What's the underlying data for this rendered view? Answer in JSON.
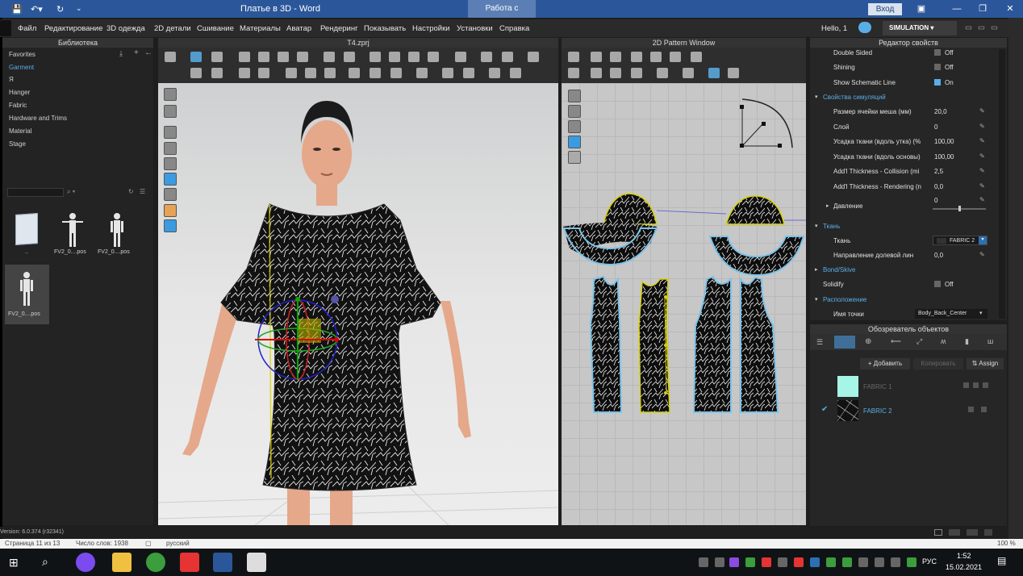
{
  "word": {
    "title": "Платье в 3D  -  Word",
    "context_tab": "Работа с рисунками",
    "signin": "Вход",
    "status_pages": "Страница 11 из 13",
    "status_words": "Число слов: 1938",
    "status_lang": "русский",
    "zoom": "100 %"
  },
  "menu": {
    "items": [
      "Файл",
      "Редактирование",
      "3D одежда",
      "2D детали",
      "Сшивание",
      "Материалы",
      "Аватар",
      "Рендеринг",
      "Показывать",
      "Настройки",
      "Установки",
      "Справка"
    ],
    "user": "Hello, 1",
    "mode": "SIMULATION"
  },
  "library": {
    "title": "Библиотека",
    "items": [
      "Favorites",
      "Garment",
      "Я",
      "Hanger",
      "Fabric",
      "Hardware and Trims",
      "Material",
      "Stage"
    ],
    "thumbs": [
      "..",
      "FV2_0....pos",
      "FV2_0....pos",
      "FV2_0....pos"
    ]
  },
  "view3d": {
    "title": "T4.zprj"
  },
  "view2d": {
    "title": "2D Pattern Window"
  },
  "props": {
    "title": "Редактор свойств",
    "rows": [
      {
        "label": "Double Sided",
        "value": "Off",
        "check": false
      },
      {
        "label": "Shining",
        "value": "Off",
        "check": false
      },
      {
        "label": "Show Schematic Line",
        "value": "On",
        "check": true
      }
    ],
    "sim_section": "Свойства симуляций",
    "sim_rows": [
      {
        "label": "Размер ячейки меша (мм)",
        "value": "20,0"
      },
      {
        "label": "Слой",
        "value": "0"
      },
      {
        "label": "Усадка ткани (вдоль утка) (%",
        "value": "100,00"
      },
      {
        "label": "Усадка ткани (вдоль основы)",
        "value": "100,00"
      },
      {
        "label": "Add'l Thickness - Collision (mi",
        "value": "2,5"
      },
      {
        "label": "Add'l Thickness - Rendering (n",
        "value": "0,0"
      }
    ],
    "pressure_label": "Давление",
    "pressure_value": "0",
    "fabric_section": "Ткань",
    "fabric_label": "Ткань",
    "fabric_value": "FABRIC 2",
    "grain_label": "Направление долевой лин",
    "grain_value": "0,0",
    "bond_section": "Bond/Skive",
    "solidify_label": "Solidify",
    "solidify_value": "Off",
    "placement_section": "Расположение",
    "point_label": "Имя точки",
    "point_value": "Body_Back_Center"
  },
  "objects": {
    "title": "Обозреватель объектов",
    "add": "+ Добавить",
    "copy": "Копировать",
    "assign": "Assign",
    "fabrics": [
      {
        "name": "FABRIC 1",
        "color": "#a7f5e6",
        "active": false
      },
      {
        "name": "FABRIC 2",
        "color": "#111111",
        "active": true
      }
    ]
  },
  "clo_status": {
    "version": "Version: 6.0.374 (r32341)"
  },
  "taskbar": {
    "lang": "РУС",
    "time": "1:52",
    "date": "15.02.2021"
  }
}
